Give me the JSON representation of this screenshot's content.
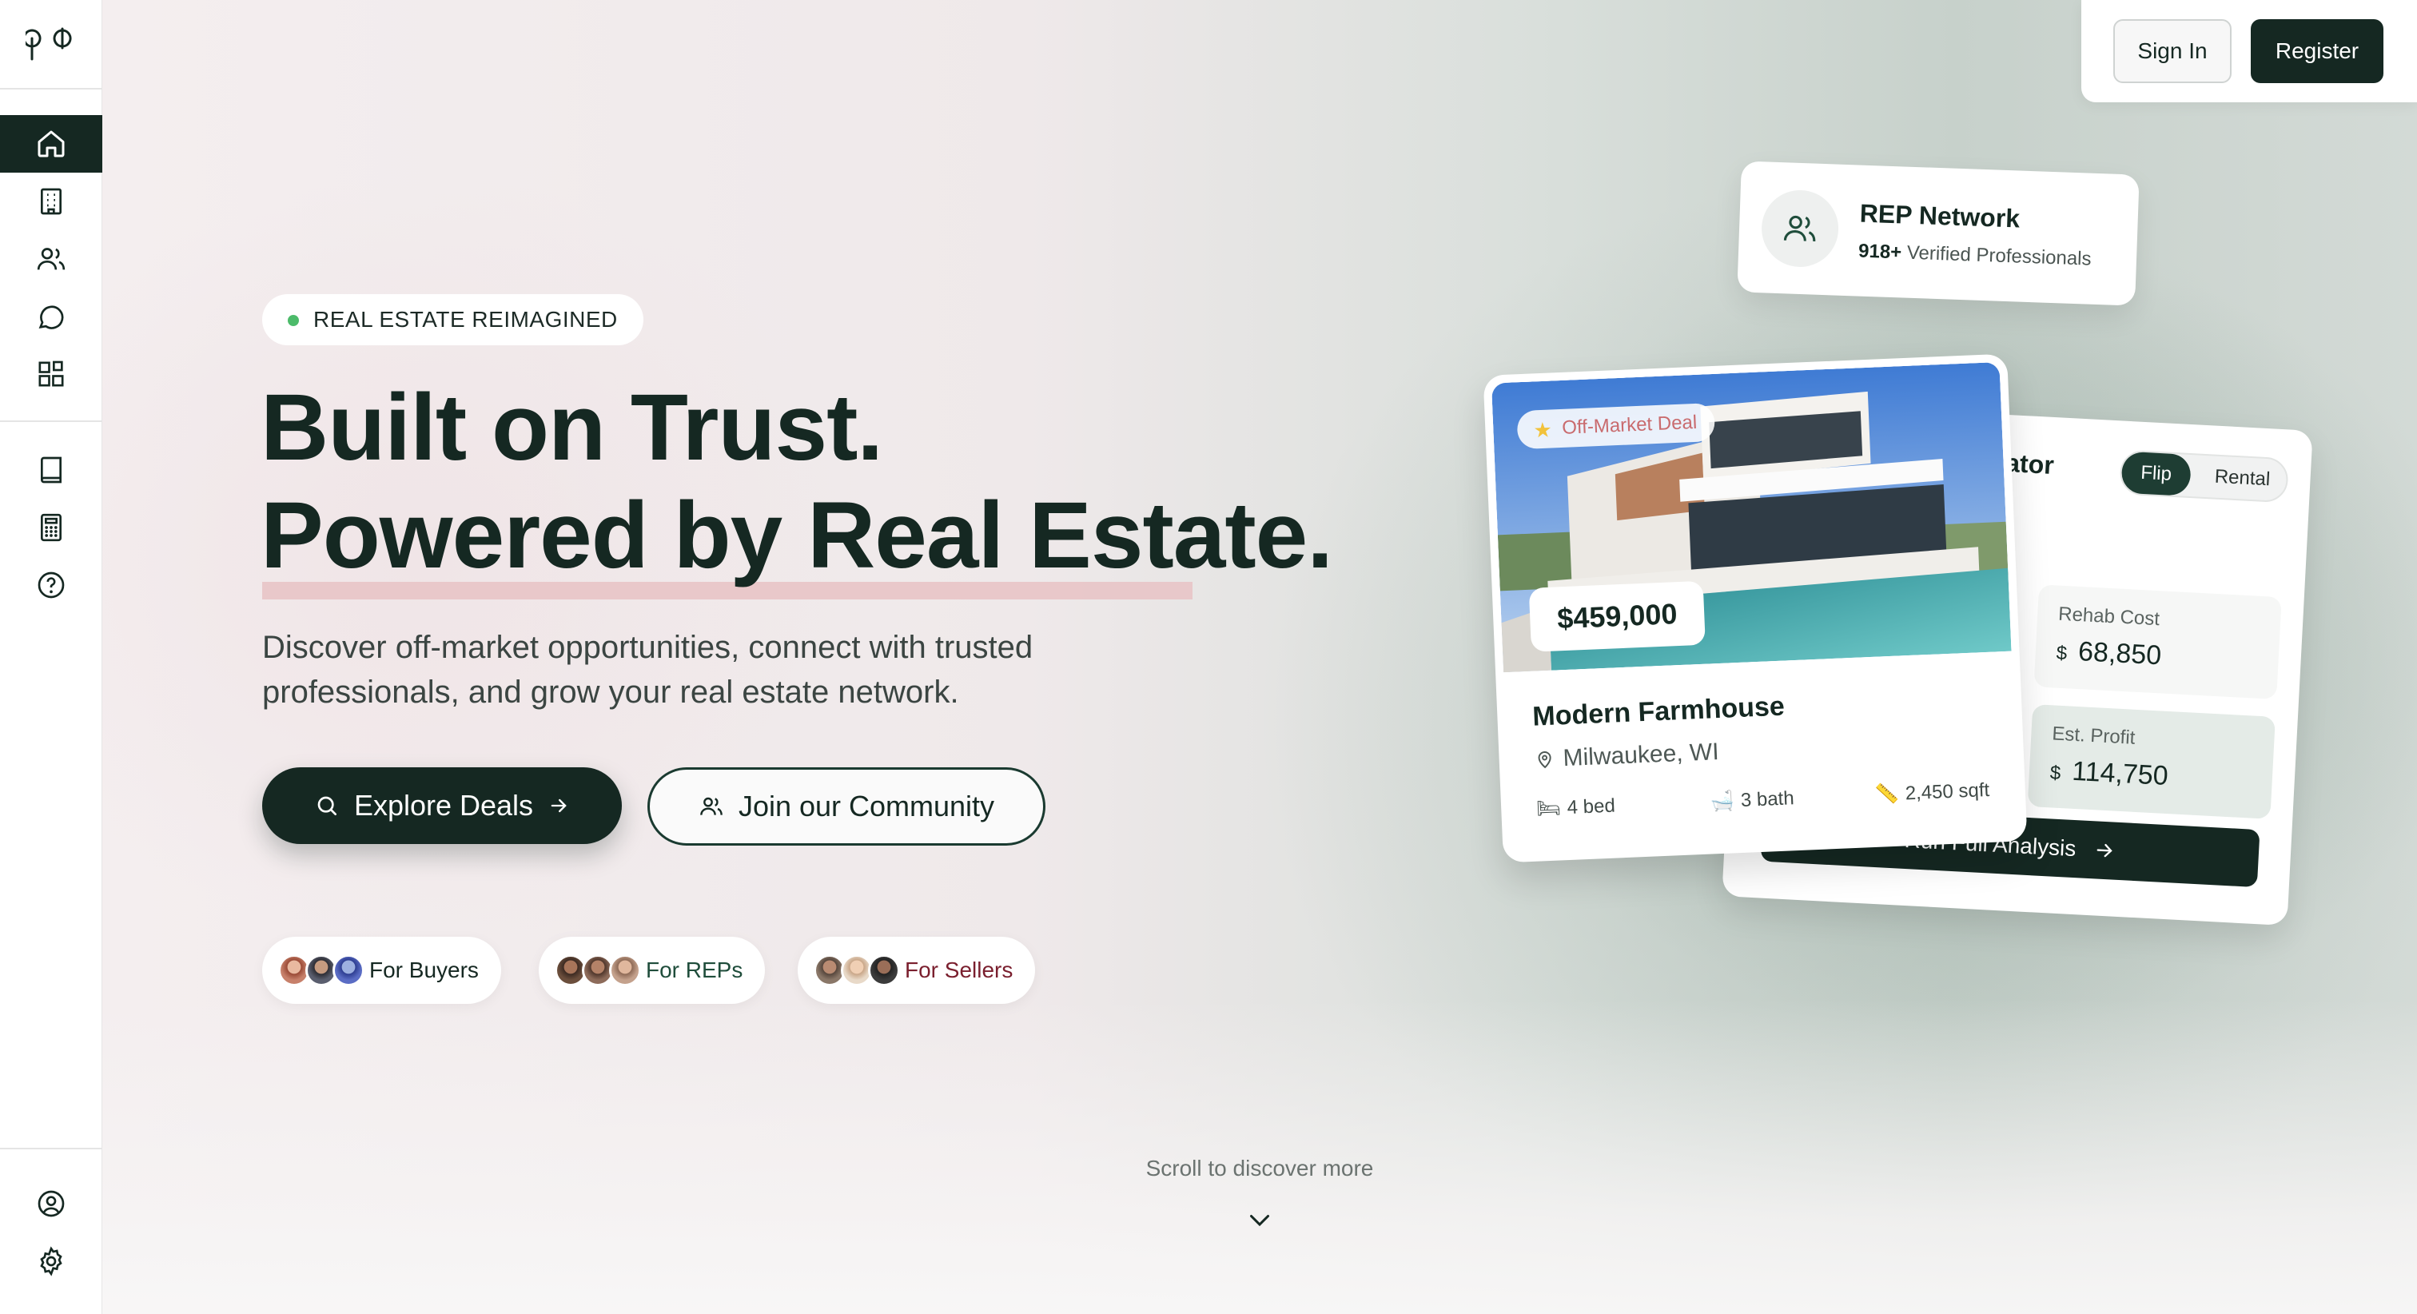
{
  "brand": {
    "logo_text": "pd"
  },
  "auth": {
    "signin_label": "Sign In",
    "register_label": "Register"
  },
  "sidebar": {
    "items": [
      {
        "icon": "home-icon",
        "active": true
      },
      {
        "icon": "building-icon"
      },
      {
        "icon": "users-icon"
      },
      {
        "icon": "message-icon"
      },
      {
        "icon": "grid-icon"
      },
      {
        "icon": "book-icon"
      },
      {
        "icon": "calculator-icon"
      },
      {
        "icon": "help-icon"
      }
    ],
    "bottom": [
      {
        "icon": "user-circle-icon"
      },
      {
        "icon": "settings-icon"
      }
    ]
  },
  "hero": {
    "badge": "REAL ESTATE REIMAGINED",
    "title_line1": "Built on Trust.",
    "title_line2": "Powered by Real Estate.",
    "subtitle": "Discover off-market opportunities, connect with trusted professionals, and grow your real estate network.",
    "cta_primary": "Explore Deals",
    "cta_secondary": "Join our Community",
    "audiences": [
      {
        "label": "For Buyers",
        "color": "#152822"
      },
      {
        "label": "For REPs",
        "color": "#1f4d3b"
      },
      {
        "label": "For Sellers",
        "color": "#7a1f2e"
      }
    ],
    "scroll_hint": "Scroll to discover more"
  },
  "network_card": {
    "title": "REP Network",
    "count": "918+",
    "count_label": "Verified Professionals"
  },
  "calculator_card": {
    "title": "culator",
    "mode_flip": "Flip",
    "mode_rental": "Rental",
    "rehab_label": "Rehab Cost",
    "rehab_currency": "$",
    "rehab_value": "68,850",
    "profit_label": "Est. Profit",
    "profit_currency": "$",
    "profit_value": "114,750",
    "action": "Run Full Analysis"
  },
  "property_card": {
    "tag": "Off-Market Deal",
    "price": "$459,000",
    "name": "Modern Farmhouse",
    "location": "Milwaukee, WI",
    "beds": "4 bed",
    "baths": "3 bath",
    "sqft": "2,450 sqft"
  },
  "colors": {
    "primary": "#152822",
    "accent_pink": "#e8c4c6",
    "accent_green": "#4cbb6a"
  }
}
